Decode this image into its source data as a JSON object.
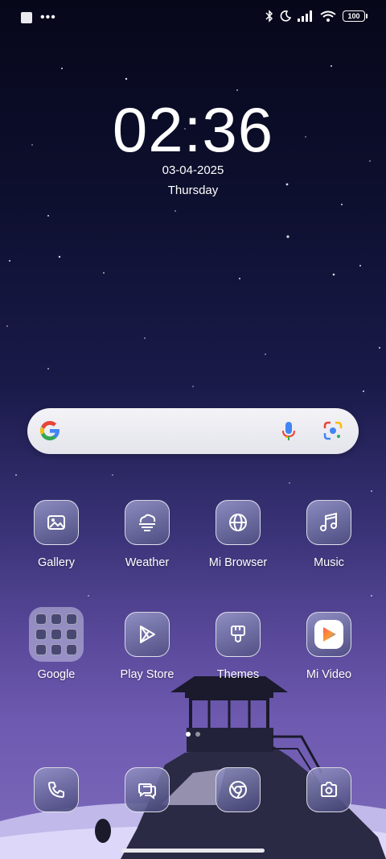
{
  "status_bar": {
    "battery": "100",
    "icons": [
      "notification-square-icon",
      "more-dots-icon",
      "bluetooth-icon",
      "moon-icon",
      "signal-icon",
      "wifi-icon",
      "battery-icon"
    ]
  },
  "clock": {
    "time": "02:36",
    "date": "03-04-2025",
    "day": "Thursday"
  },
  "search": {
    "icons": [
      "google-g-icon",
      "mic-icon",
      "google-lens-icon"
    ]
  },
  "apps_row1": [
    {
      "label": "Gallery",
      "icon": "gallery-icon"
    },
    {
      "label": "Weather",
      "icon": "weather-icon"
    },
    {
      "label": "Mi Browser",
      "icon": "globe-icon"
    },
    {
      "label": "Music",
      "icon": "music-note-icon"
    }
  ],
  "apps_row2": [
    {
      "label": "Google",
      "icon": "folder-icon"
    },
    {
      "label": "Play Store",
      "icon": "play-store-icon"
    },
    {
      "label": "Themes",
      "icon": "brush-icon"
    },
    {
      "label": "Mi Video",
      "icon": "mi-video-icon"
    }
  ],
  "dock": [
    {
      "icon": "phone-icon"
    },
    {
      "icon": "messages-icon"
    },
    {
      "icon": "chrome-icon"
    },
    {
      "icon": "camera-icon"
    }
  ],
  "pager": {
    "pages": 2,
    "current": 1
  },
  "colors": {
    "accent_blue": "#4285F4",
    "accent_red": "#EA4335",
    "accent_yellow": "#FBBC05",
    "accent_green": "#34A853"
  }
}
